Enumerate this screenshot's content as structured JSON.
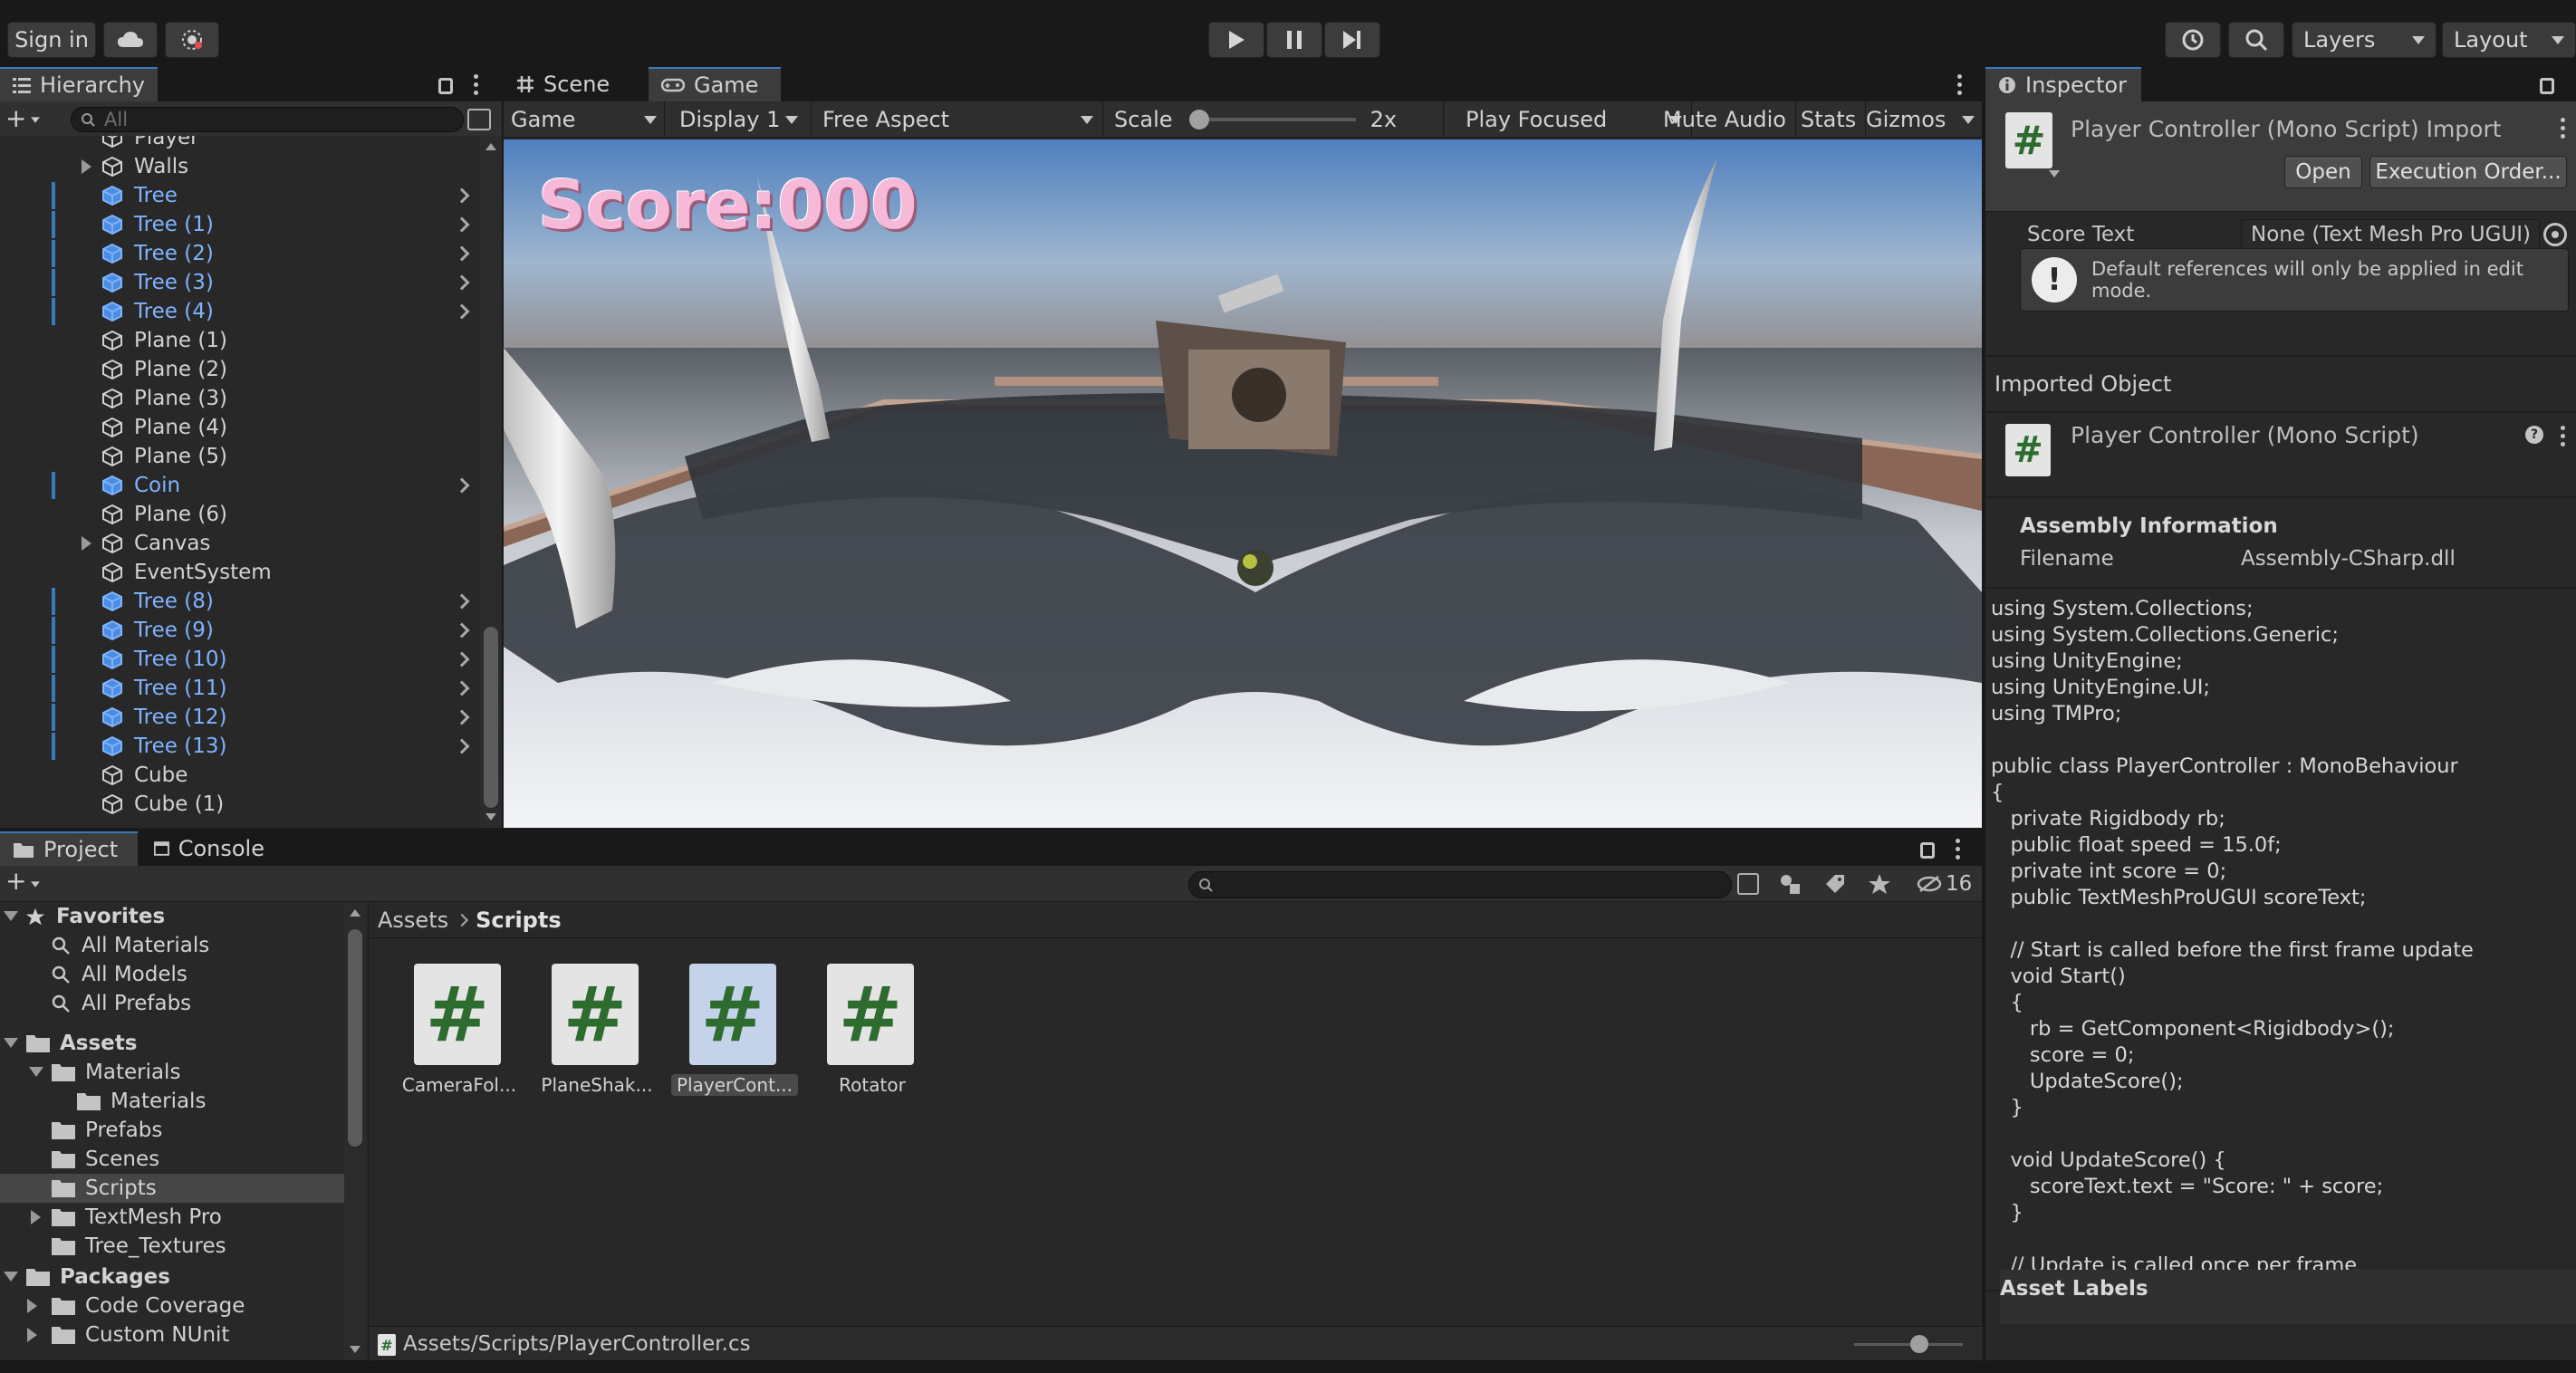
{
  "toolbar": {
    "sign_in": "Sign in",
    "layers": "Layers",
    "layout": "Layout"
  },
  "hierarchy": {
    "tab": "Hierarchy",
    "search_placeholder": "All",
    "items": [
      {
        "label": "Player",
        "prefab": false
      },
      {
        "label": "Walls",
        "prefab": false,
        "foldout": true
      },
      {
        "label": "Tree",
        "prefab": true
      },
      {
        "label": "Tree (1)",
        "prefab": true
      },
      {
        "label": "Tree (2)",
        "prefab": true
      },
      {
        "label": "Tree (3)",
        "prefab": true
      },
      {
        "label": "Tree (4)",
        "prefab": true
      },
      {
        "label": "Plane (1)",
        "prefab": false
      },
      {
        "label": "Plane (2)",
        "prefab": false
      },
      {
        "label": "Plane (3)",
        "prefab": false
      },
      {
        "label": "Plane (4)",
        "prefab": false
      },
      {
        "label": "Plane (5)",
        "prefab": false
      },
      {
        "label": "Coin",
        "prefab": true
      },
      {
        "label": "Plane (6)",
        "prefab": false
      },
      {
        "label": "Canvas",
        "prefab": false,
        "foldout": true
      },
      {
        "label": "EventSystem",
        "prefab": false
      },
      {
        "label": "Tree (8)",
        "prefab": true
      },
      {
        "label": "Tree (9)",
        "prefab": true
      },
      {
        "label": "Tree (10)",
        "prefab": true
      },
      {
        "label": "Tree (11)",
        "prefab": true
      },
      {
        "label": "Tree (12)",
        "prefab": true
      },
      {
        "label": "Tree (13)",
        "prefab": true
      },
      {
        "label": "Cube",
        "prefab": false
      },
      {
        "label": "Cube (1)",
        "prefab": false
      }
    ]
  },
  "game_view": {
    "tab_scene": "Scene",
    "tab_game": "Game",
    "mode": "Game",
    "display": "Display 1",
    "aspect": "Free Aspect",
    "scale_label": "Scale",
    "scale_value": "2x",
    "scale_fraction": 0.0,
    "play_mode": "Play Focused",
    "mute": "Mute Audio",
    "stats": "Stats",
    "gizmos": "Gizmos",
    "score_text": "Score:000"
  },
  "project": {
    "tab_project": "Project",
    "tab_console": "Console",
    "hidden_count": "16",
    "favorites": {
      "label": "Favorites",
      "items": [
        "All Materials",
        "All Models",
        "All Prefabs"
      ]
    },
    "assets_label": "Assets",
    "tree": [
      {
        "label": "Materials",
        "indent": 1,
        "expanded": true
      },
      {
        "label": "Materials",
        "indent": 2
      },
      {
        "label": "Prefabs",
        "indent": 1
      },
      {
        "label": "Scenes",
        "indent": 1
      },
      {
        "label": "Scripts",
        "indent": 1,
        "selected": true
      },
      {
        "label": "TextMesh Pro",
        "indent": 1,
        "collapsed": true
      },
      {
        "label": "Tree_Textures",
        "indent": 1
      }
    ],
    "packages_label": "Packages",
    "packages": [
      {
        "label": "Code Coverage"
      },
      {
        "label": "Custom NUnit"
      }
    ],
    "breadcrumb_root": "Assets",
    "breadcrumb_current": "Scripts",
    "files": [
      {
        "name": "CameraFol...",
        "selected": false
      },
      {
        "name": "PlaneShak...",
        "selected": false
      },
      {
        "name": "PlayerCont...",
        "selected": true
      },
      {
        "name": "Rotator",
        "selected": false
      }
    ],
    "status_path": "Assets/Scripts/PlayerController.cs"
  },
  "inspector": {
    "tab": "Inspector",
    "title": "Player Controller (Mono Script) Import",
    "open_button": "Open",
    "exec_button": "Execution Order...",
    "score_field_label": "Score Text",
    "score_field_value": "None (Text Mesh Pro UGUI)",
    "warning": "Default references will only be applied in edit mode.",
    "imported_object": "Imported Object",
    "object_title": "Player Controller (Mono Script)",
    "assembly_info": "Assembly Information",
    "filename_label": "Filename",
    "filename_value": "Assembly-CSharp.dll",
    "code": "using System.Collections;\nusing System.Collections.Generic;\nusing UnityEngine;\nusing UnityEngine.UI;\nusing TMPro;\n\npublic class PlayerController : MonoBehaviour\n{\n   private Rigidbody rb;\n   public float speed = 15.0f;\n   private int score = 0;\n   public TextMeshProUGUI scoreText;\n\n   // Start is called before the first frame update\n   void Start()\n   {\n      rb = GetComponent<Rigidbody>();\n      score = 0;\n      UpdateScore();\n   }\n\n   void UpdateScore() {\n      scoreText.text = \"Score: \" + score;\n   }\n\n   // Update is called once per frame",
    "asset_labels": "Asset Labels"
  }
}
